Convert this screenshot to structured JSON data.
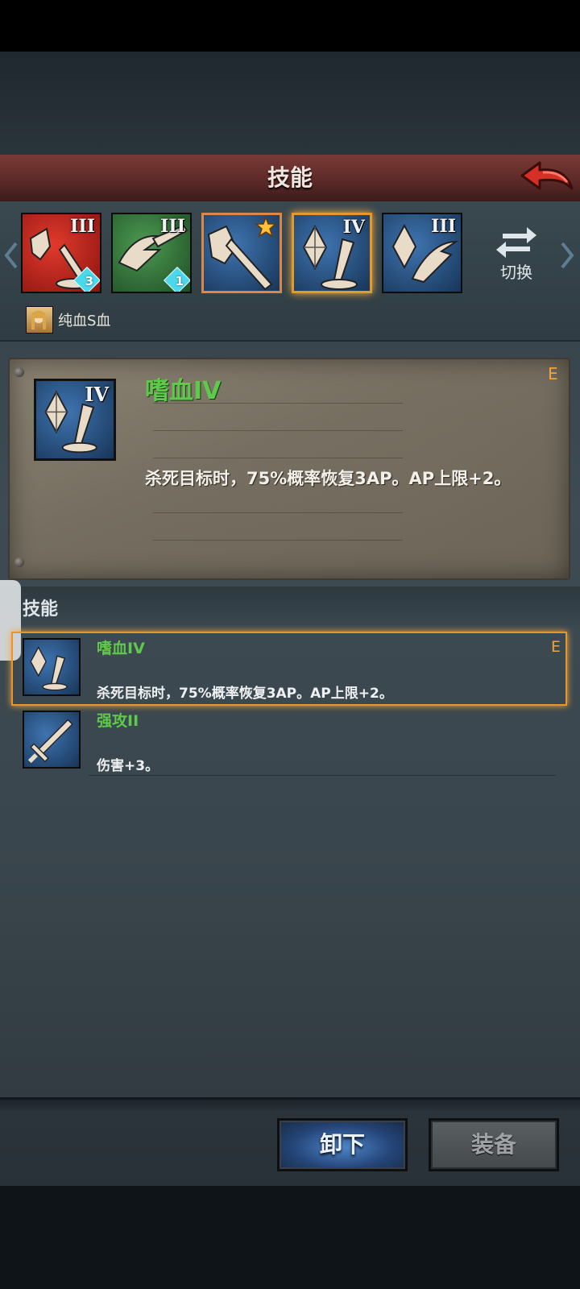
{
  "header": {
    "title": "技能"
  },
  "skill_bar": {
    "slots": [
      {
        "rank": "III",
        "badge": "3",
        "color": "red",
        "state": "normal"
      },
      {
        "rank": "III",
        "badge": "1",
        "color": "green",
        "state": "normal"
      },
      {
        "rank": "",
        "badge": "",
        "color": "blue",
        "state": "starred"
      },
      {
        "rank": "IV",
        "badge": "",
        "color": "blue",
        "state": "selected"
      },
      {
        "rank": "III",
        "badge": "",
        "color": "blue",
        "state": "normal"
      }
    ],
    "switch_label": "切换",
    "bloodline_label": "纯血S血"
  },
  "detail": {
    "name": "嗜血IV",
    "rank": "IV",
    "grade": "E",
    "description": "杀死目标时，75%概率恢复3AP。AP上限+2。"
  },
  "skills_section": {
    "title": "技能",
    "items": [
      {
        "name": "嗜血IV",
        "description": "杀死目标时，75%概率恢复3AP。AP上限+2。",
        "grade": "E",
        "selected": true
      },
      {
        "name": "强攻II",
        "description": "伤害+3。",
        "grade": "",
        "selected": false
      }
    ]
  },
  "buttons": {
    "unequip": "卸下",
    "equip": "装备"
  },
  "colors": {
    "skill_name": "#5ec94a",
    "grade": "#f3a13a",
    "selection": "#e8962a",
    "header": "#5c2a28",
    "unequip_button": "#25467a"
  }
}
